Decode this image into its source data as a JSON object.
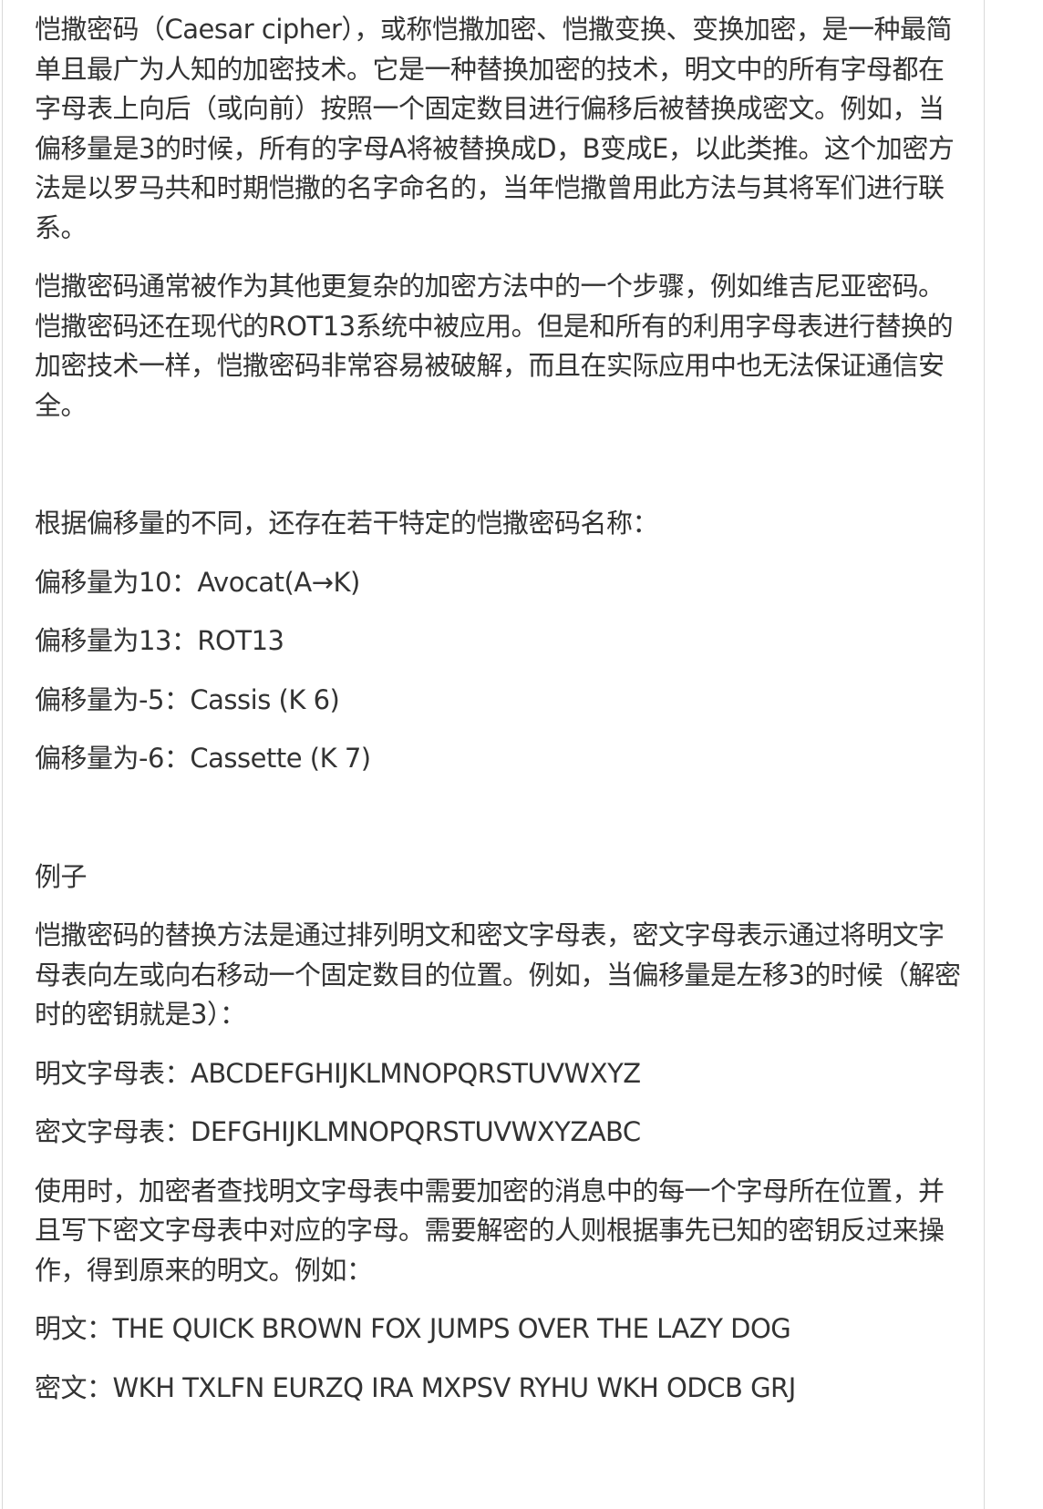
{
  "intro": {
    "p1": "恺撒密码（Caesar cipher），或称恺撒加密、恺撒变换、变换加密，是一种最简单且最广为人知的加密技术。它是一种替换加密的技术，明文中的所有字母都在字母表上向后（或向前）按照一个固定数目进行偏移后被替换成密文。例如，当偏移量是3的时候，所有的字母A将被替换成D，B变成E，以此类推。这个加密方法是以罗马共和时期恺撒的名字命名的，当年恺撒曾用此方法与其将军们进行联系。",
    "p2": "恺撒密码通常被作为其他更复杂的加密方法中的一个步骤，例如维吉尼亚密码。恺撒密码还在现代的ROT13系统中被应用。但是和所有的利用字母表进行替换的加密技术一样，恺撒密码非常容易被破解，而且在实际应用中也无法保证通信安全。"
  },
  "variants": {
    "heading": "根据偏移量的不同，还存在若干特定的恺撒密码名称：",
    "items": [
      "偏移量为10：Avocat(A→K)",
      "偏移量为13：ROT13",
      "偏移量为-5：Cassis (K 6)",
      "偏移量为-6：Cassette (K 7)"
    ]
  },
  "example": {
    "heading": "例子",
    "p1": "恺撒密码的替换方法是通过排列明文和密文字母表，密文字母表示通过将明文字母表向左或向右移动一个固定数目的位置。例如，当偏移量是左移3的时候（解密时的密钥就是3）：",
    "plain_alphabet": "明文字母表：ABCDEFGHIJKLMNOPQRSTUVWXYZ",
    "cipher_alphabet": "密文字母表：DEFGHIJKLMNOPQRSTUVWXYZABC",
    "p2": "使用时，加密者查找明文字母表中需要加密的消息中的每一个字母所在位置，并且写下密文字母表中对应的字母。需要解密的人则根据事先已知的密钥反过来操作，得到原来的明文。例如：",
    "plaintext": "明文：THE QUICK BROWN FOX JUMPS OVER THE LAZY DOG",
    "ciphertext": "密文：WKH TXLFN EURZQ IRA MXPSV RYHU WKH ODCB GRJ"
  }
}
